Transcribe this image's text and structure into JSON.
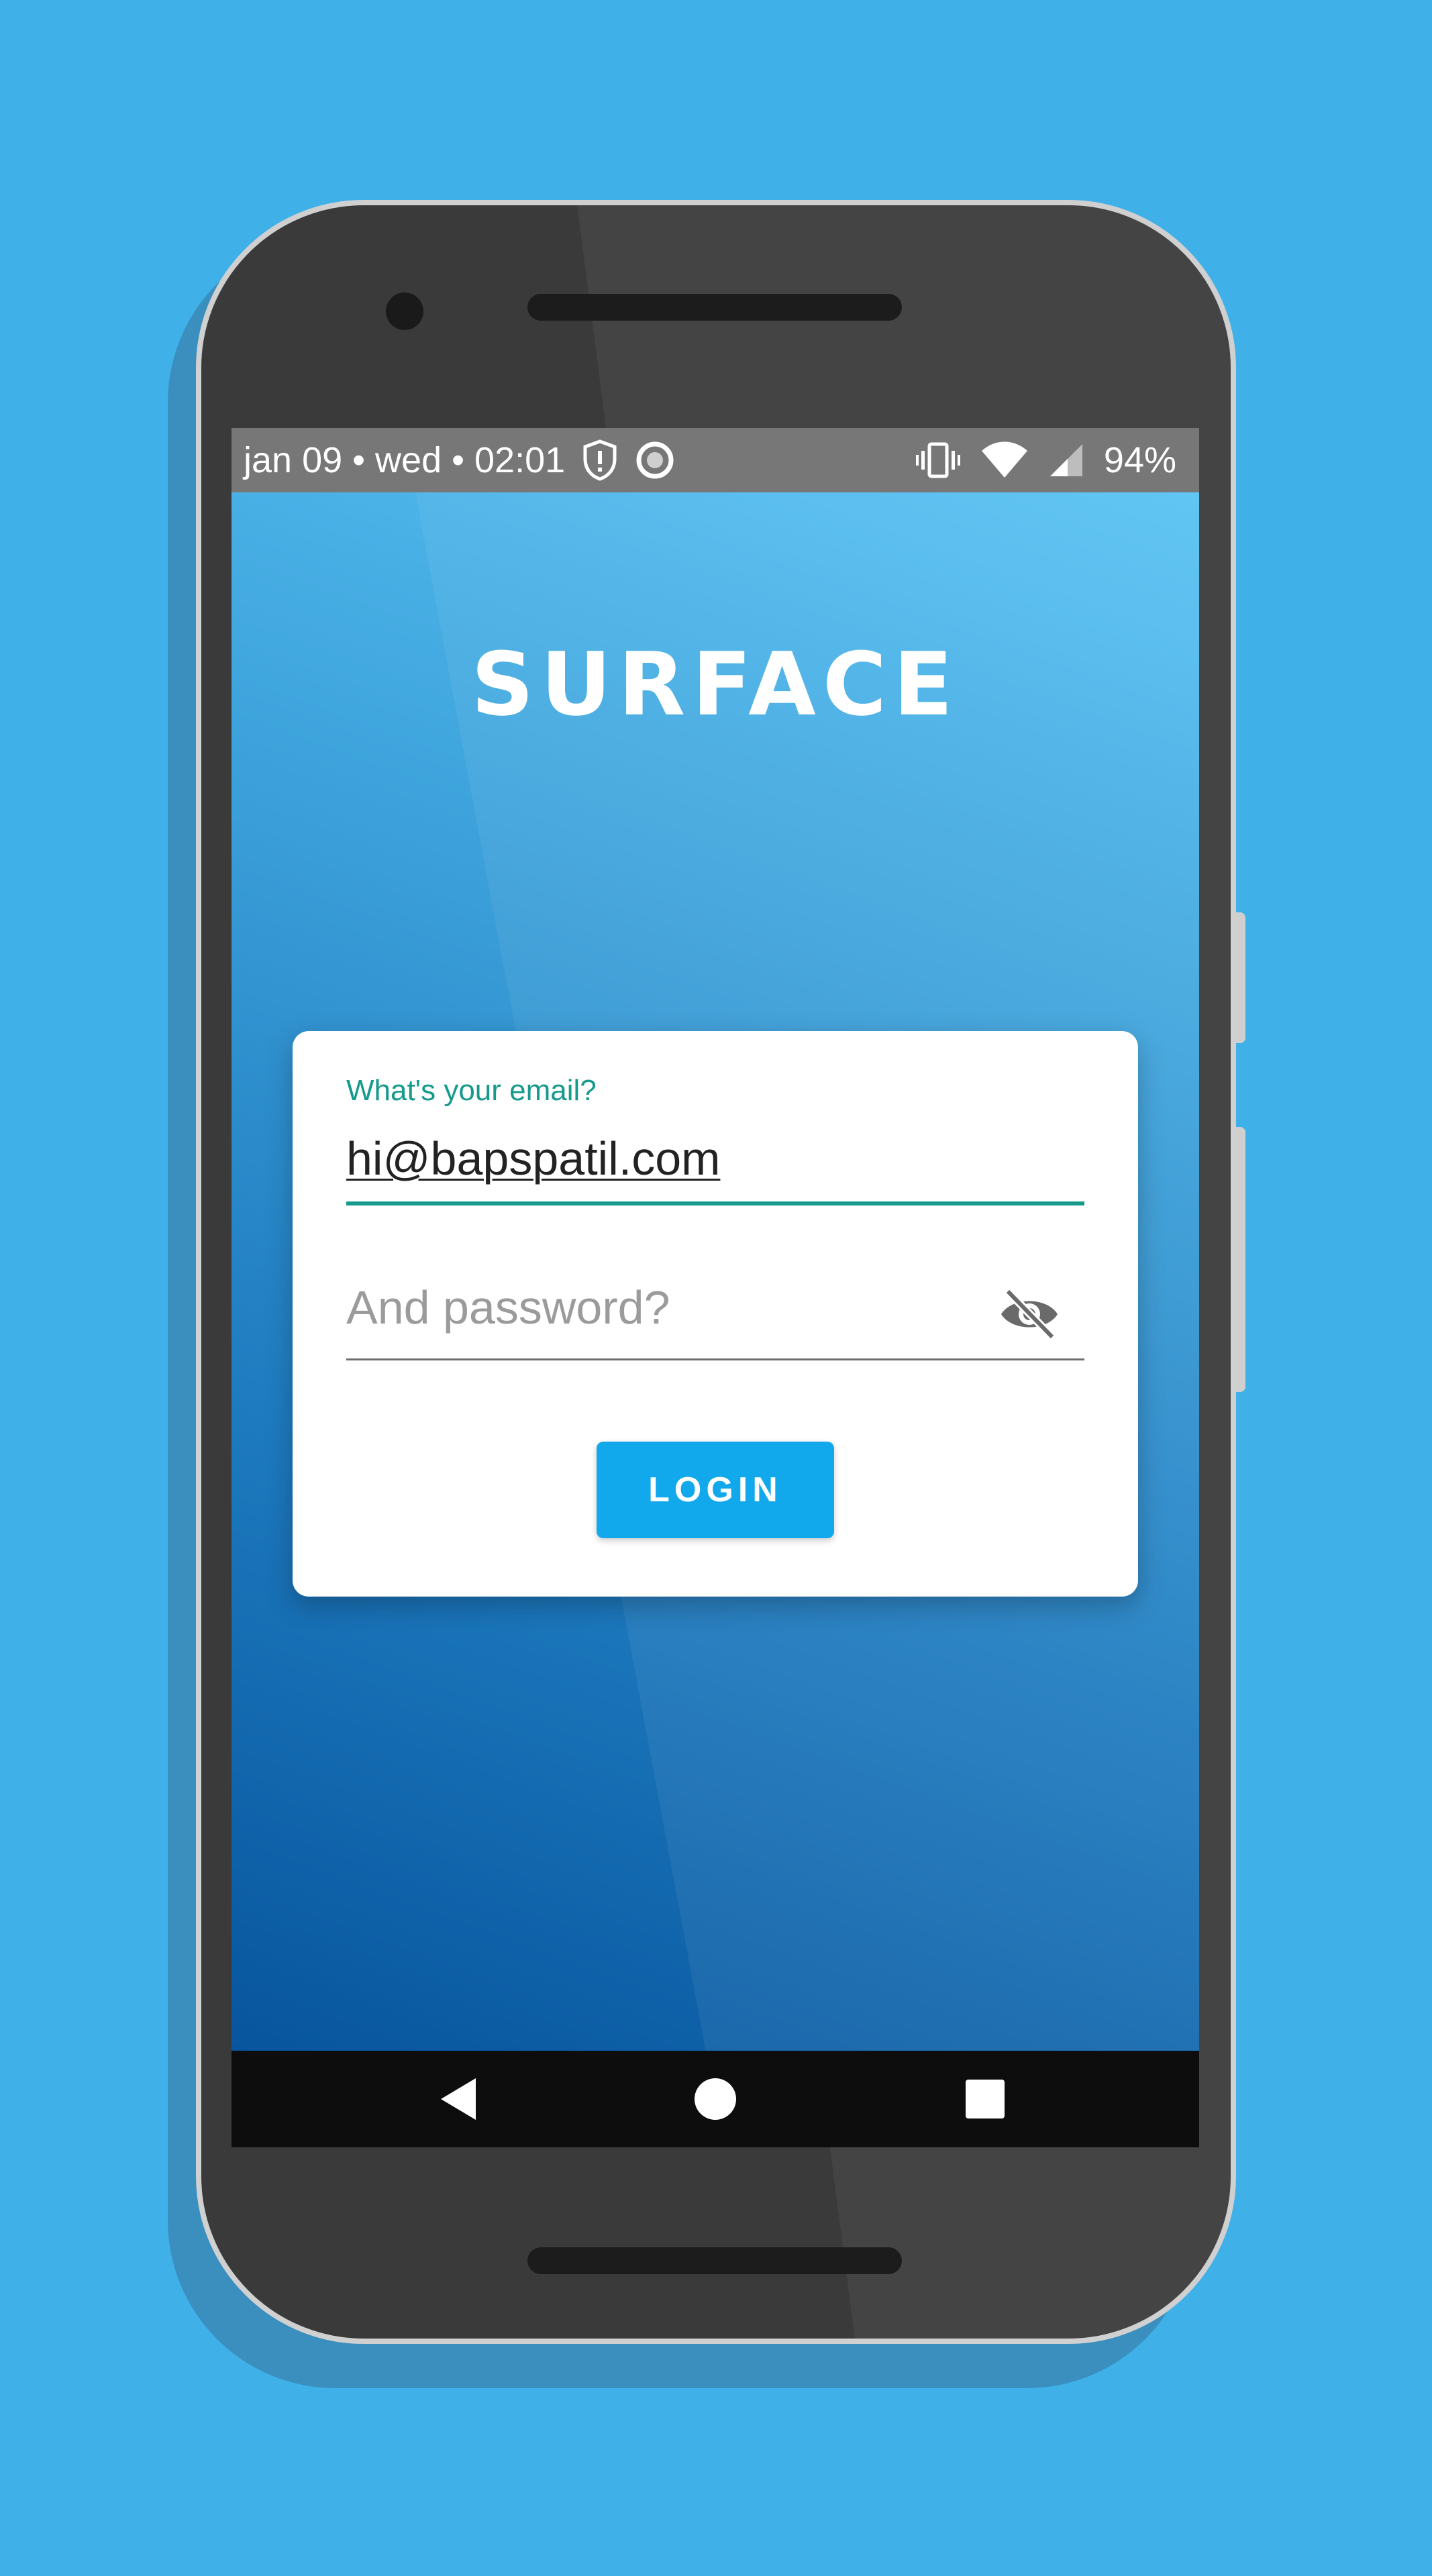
{
  "status_bar": {
    "date_time": "jan 09 • wed • 02:01",
    "battery": "94%"
  },
  "app": {
    "logo": "SURFACE"
  },
  "login_form": {
    "email_label": "What's your email?",
    "email_value": "hi@bapspatil.com",
    "password_placeholder": "And password?",
    "login_label": "LOGIN"
  },
  "colors": {
    "background": "#40b0e8",
    "accent": "#159a8c",
    "login_button": "#12a9ec"
  },
  "icons": {
    "status_left": [
      "shield-alert-icon",
      "record-icon"
    ],
    "status_right": [
      "vibrate-icon",
      "wifi-icon",
      "cell-signal-icon"
    ],
    "password_toggle": "eye-off-icon",
    "navigation": [
      "back-icon",
      "home-icon",
      "recents-icon"
    ]
  }
}
